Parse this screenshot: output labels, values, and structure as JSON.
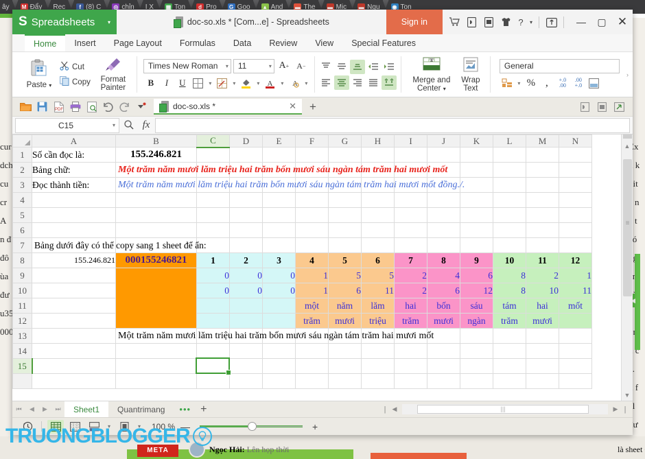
{
  "background": {
    "tabs": [
      {
        "label": "ây",
        "color": "#555"
      },
      {
        "label": "Đẩy",
        "color": "#d32f2f",
        "glyph": "M"
      },
      {
        "label": "Rec",
        "color": "#2f80c0",
        "glyph": ""
      },
      {
        "label": "(8) C",
        "color": "#3b5998",
        "glyph": "f"
      },
      {
        "label": "chỉn",
        "color": "#8a3ab9",
        "glyph": "◎"
      },
      {
        "label": "I X",
        "color": "#e6a817",
        "glyph": ""
      },
      {
        "label": "Ton",
        "color": "#3fa64b",
        "glyph": "▦"
      },
      {
        "label": "Pro",
        "color": "#d32f2f",
        "glyph": "d"
      },
      {
        "label": "Goo",
        "color": "#2f6fc0",
        "glyph": "G"
      },
      {
        "label": "And",
        "color": "#8bc34a",
        "glyph": "▲"
      },
      {
        "label": "The",
        "color": "#e0523c",
        "glyph": "▬"
      },
      {
        "label": "Mic",
        "color": "#c0392b",
        "glyph": "▬"
      },
      {
        "label": "Ngu",
        "color": "#c0392b",
        "glyph": "▬"
      },
      {
        "label": "Ton",
        "color": "#2f80c0",
        "glyph": "◉"
      }
    ],
    "left_text": [
      "cur",
      "dch",
      "cu",
      "cr",
      "",
      "A",
      "n đ",
      "đô",
      "ùa",
      "",
      "",
      "đư",
      "u35",
      "",
      "",
      "",
      "000"
    ],
    "right_text": [
      "Ex",
      "",
      "u k",
      "bit",
      "c n",
      "á t",
      "có",
      "ng",
      "àn",
      "sử",
      "c q",
      "on",
      "n c",
      "e.",
      "n f",
      "el",
      "đư"
    ],
    "comment_author": "Ngọc Hải:",
    "comment_text": "Lên họp thời",
    "meta_badge": "META",
    "bottom_right_text": "là sheet Quantrim"
  },
  "titlebar": {
    "brand_logo": "S",
    "brand_name": "Spreadsheets",
    "brand_caret": "▾",
    "doc_title": "doc-so.xls * [Com...e] - Spreadsheets",
    "signin_label": "Sign in",
    "icons": [
      {
        "name": "cart-icon",
        "glyph": "🛒"
      },
      {
        "name": "pdf-icon",
        "glyph": "🅓"
      },
      {
        "name": "image-icon",
        "glyph": "🅰"
      },
      {
        "name": "skin-icon",
        "glyph": "👕"
      },
      {
        "name": "help-icon",
        "glyph": "?"
      }
    ],
    "help_caret": "▾",
    "share_icon": "⬆",
    "minimize": "—",
    "maximize": "▢",
    "close": "✕"
  },
  "ribbon_tabs": [
    {
      "label": "Home",
      "active": true
    },
    {
      "label": "Insert",
      "active": false
    },
    {
      "label": "Page Layout",
      "active": false
    },
    {
      "label": "Formulas",
      "active": false
    },
    {
      "label": "Data",
      "active": false
    },
    {
      "label": "Review",
      "active": false
    },
    {
      "label": "View",
      "active": false
    },
    {
      "label": "Special Features",
      "active": false
    }
  ],
  "ribbon": {
    "paste_label": "Paste",
    "paste_caret": "▾",
    "cut_label": "Cut",
    "copy_label": "Copy",
    "format_painter_label_1": "Format",
    "format_painter_label_2": "Painter",
    "font_name": "Times New Roman",
    "font_size": "11",
    "grow_font": "A",
    "shrink_font": "A",
    "bold": "B",
    "italic": "I",
    "underline": "U",
    "merge_label_1": "Merge and",
    "merge_label_2": "Center",
    "merge_caret": "▾",
    "wrap_label_1": "Wrap",
    "wrap_label_2": "Text",
    "number_format": "General",
    "percent": "%",
    "comma": ",",
    "inc_decimal": "+.0",
    "dec_decimal": ".00",
    "dropdown_caret": "▾"
  },
  "quickbar": {
    "icons": [
      {
        "name": "open-icon",
        "glyph": "📂"
      },
      {
        "name": "save-icon",
        "glyph": "💾"
      },
      {
        "name": "export-pdf-icon",
        "glyph": "📄"
      },
      {
        "name": "print-icon",
        "glyph": "🖨"
      },
      {
        "name": "print-preview-icon",
        "glyph": "🔍"
      },
      {
        "name": "undo-icon",
        "glyph": "↶"
      },
      {
        "name": "redo-icon",
        "glyph": "↷"
      },
      {
        "name": "customize-icon",
        "glyph": "▾"
      }
    ],
    "doc_tab_label": "doc-so.xls *",
    "doc_tab_close": "✕",
    "new_tab": "+",
    "right_icons": [
      {
        "name": "doc-view-icon",
        "glyph": "🄳"
      },
      {
        "name": "lock-icon",
        "glyph": "🄰"
      },
      {
        "name": "share-doc-icon",
        "glyph": "🄴"
      }
    ]
  },
  "formulabar": {
    "namebox_value": "C15",
    "namebox_caret": "▾",
    "search_icon": "🔍",
    "fx_label": "fx",
    "formula_value": ""
  },
  "grid": {
    "column_headers": [
      "A",
      "B",
      "C",
      "D",
      "E",
      "F",
      "G",
      "H",
      "I",
      "J",
      "K",
      "L",
      "M",
      "N"
    ],
    "selected_column": "C",
    "row_headers": [
      "1",
      "2",
      "3",
      "4",
      "5",
      "6",
      "7",
      "8",
      "9",
      "10",
      "11",
      "12",
      "13",
      "14",
      "15"
    ],
    "selected_row": "15",
    "selected_cell": "C15",
    "cells": {
      "A1": "Số cần đọc là:",
      "B1": "155.246.821",
      "A2": "Bảng chữ:",
      "B2": "Một trăm năm mươi lăm triệu hai trăm bốn mươi sáu ngàn tám trăm hai mươi mốt",
      "A3": "Đọc thành tiền:",
      "B3": "Một trăm năm mươi lăm triệu hai trăm bốn mươi sáu ngàn tám trăm hai mươi mốt đồng./.",
      "A7": "Bảng dưới đây có thể copy sang 1 sheet để ẩn:",
      "A8": "155.246.821",
      "B8": "000155246821",
      "B13": "Một trăm năm mươi lăm triệu hai trăm bốn mươi sáu ngàn tám trăm hai mươi mốt"
    },
    "digit_table": {
      "header_row": "8",
      "columns": [
        "C",
        "D",
        "E",
        "F",
        "G",
        "H",
        "I",
        "J",
        "K",
        "L",
        "M",
        "N"
      ],
      "indices": [
        "1",
        "2",
        "3",
        "4",
        "5",
        "6",
        "7",
        "8",
        "9",
        "10",
        "11",
        "12"
      ],
      "row9": [
        "0",
        "0",
        "0",
        "1",
        "5",
        "5",
        "2",
        "4",
        "6",
        "8",
        "2",
        "1"
      ],
      "row10": [
        "0",
        "0",
        "0",
        "1",
        "6",
        "11",
        "2",
        "6",
        "12",
        "8",
        "10",
        "11"
      ],
      "row11": [
        "",
        "",
        "",
        "một",
        "năm",
        "lăm",
        "hai",
        "bốn",
        "sáu",
        "tám",
        "hai",
        "mốt"
      ],
      "row12": [
        "",
        "",
        "",
        "trăm",
        "mươi",
        "triệu",
        "trăm",
        "mươi",
        "ngàn",
        "trăm",
        "mươi",
        ""
      ],
      "group_colors": {
        "cyan": "#d4f7f7",
        "peach": "#fbc98e",
        "pink": "#fb94c8",
        "green": "#c6f0bd",
        "orange": "#ff9900"
      },
      "digit_color": "#3b2fd8",
      "b8_color": "#4a1a8c"
    },
    "text_colors": {
      "red": "#e8231c",
      "blue": "#4a6fd8",
      "black": "#000000"
    }
  },
  "sheetbar": {
    "nav_first": "⏮",
    "nav_prev": "◀",
    "nav_next": "▶",
    "nav_last": "⏭",
    "tabs": [
      {
        "label": "Sheet1",
        "active": true
      },
      {
        "label": "Quantrimang",
        "active": false
      }
    ],
    "dots": "•••",
    "plus": "+",
    "hs_left_end": "|",
    "hs_left": "◀",
    "hs_right": "▶",
    "hs_right_end": "|"
  },
  "statusbar": {
    "history_icon": "🕘",
    "views": [
      {
        "name": "normal-view-icon",
        "glyph": "▦",
        "selected": true
      },
      {
        "name": "page-break-view-icon",
        "glyph": "▩",
        "selected": false
      },
      {
        "name": "page-layout-view-icon",
        "glyph": "▤",
        "selected": false
      },
      {
        "name": "reading-view-icon",
        "glyph": "▣",
        "selected": false
      }
    ],
    "zoom_label": "100 %",
    "zoom_minus": "—",
    "zoom_plus": "+"
  },
  "watermark": {
    "text": "TRUONGBLOGGER",
    "bulb_glyph": "💡",
    "color": "#35b6e8"
  }
}
